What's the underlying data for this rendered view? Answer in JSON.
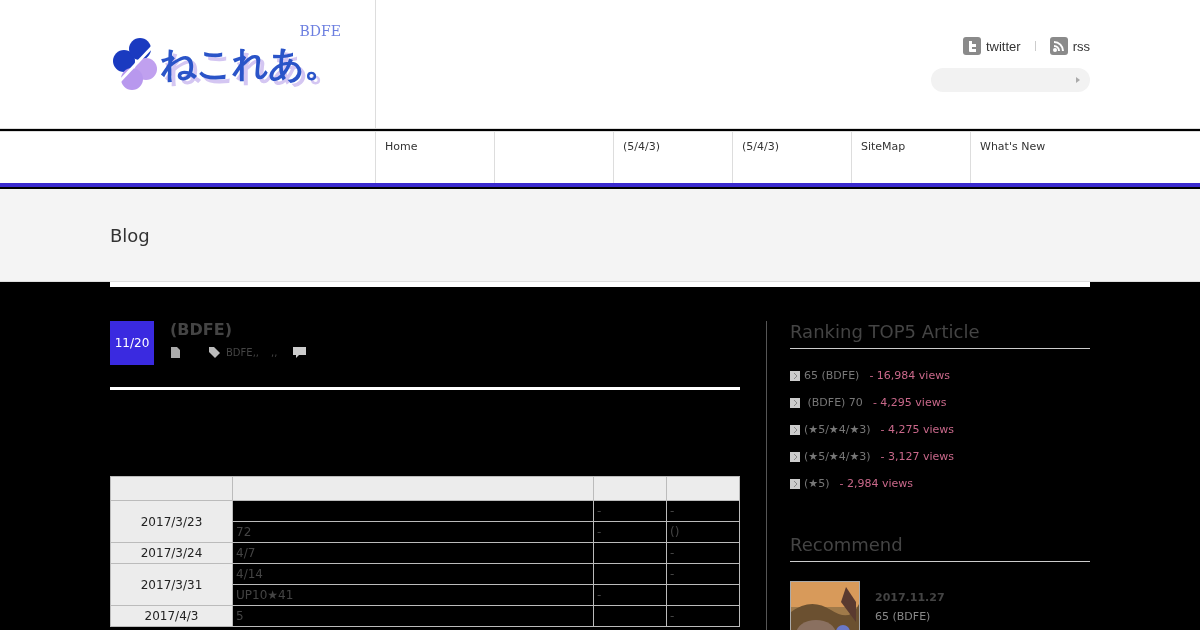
{
  "logo": {
    "text": "ねこれあ。",
    "tag": "BDFE"
  },
  "social": [
    {
      "kind": "twitter",
      "label": "twitter"
    },
    {
      "kind": "rss",
      "label": "rss"
    }
  ],
  "nav": [
    {
      "kind": "link",
      "label": "Home"
    },
    {
      "kind": "blank"
    },
    {
      "kind": "link",
      "label": "(5/4/3)"
    },
    {
      "kind": "link",
      "label": "(5/4/3)"
    },
    {
      "kind": "link",
      "label": "SiteMap"
    },
    {
      "kind": "link",
      "label": "What's New"
    }
  ],
  "page_title": "Blog",
  "post": {
    "date": "11/20",
    "title": "(BDFE)",
    "tags": "BDFE,,",
    "tags_2": ",,"
  },
  "table": {
    "rows": [
      {
        "date": "2017/3/23",
        "entries": [
          {
            "column_3": "-",
            "column_4": "-"
          },
          {
            "column_2": "72",
            "column_3": "-",
            "column_4": "()"
          }
        ]
      },
      {
        "date": "2017/3/24",
        "entries": [
          {
            "column_2": " 4/7",
            "column_4": "-"
          }
        ]
      },
      {
        "date": "2017/3/31",
        "entries": [
          {
            "column_2": " 4/14",
            "column_4": "-"
          },
          {
            "column_2": "UP10★41",
            "column_3": "-"
          }
        ]
      },
      {
        "date": "2017/4/3",
        "entries": [
          {
            "column_2": "5",
            "column_4": "-"
          }
        ]
      }
    ]
  },
  "ranking": {
    "title": "Ranking TOP5 Article",
    "items": [
      {
        "title": "65 (BDFE)",
        "views": "- 16,984 views"
      },
      {
        "title": " (BDFE) 70",
        "views": "- 4,295 views"
      },
      {
        "title": "(★5/★4/★3)",
        "views": "- 4,275 views"
      },
      {
        "title": "(★5/★4/★3)",
        "views": "- 3,127 views"
      },
      {
        "title": "(★5)",
        "views": "- 2,984 views"
      }
    ]
  },
  "recommend": {
    "title": "Recommend",
    "items": [
      {
        "kind": "picture",
        "date": "2017.11.27",
        "title": "65 (BDFE)"
      }
    ]
  }
}
